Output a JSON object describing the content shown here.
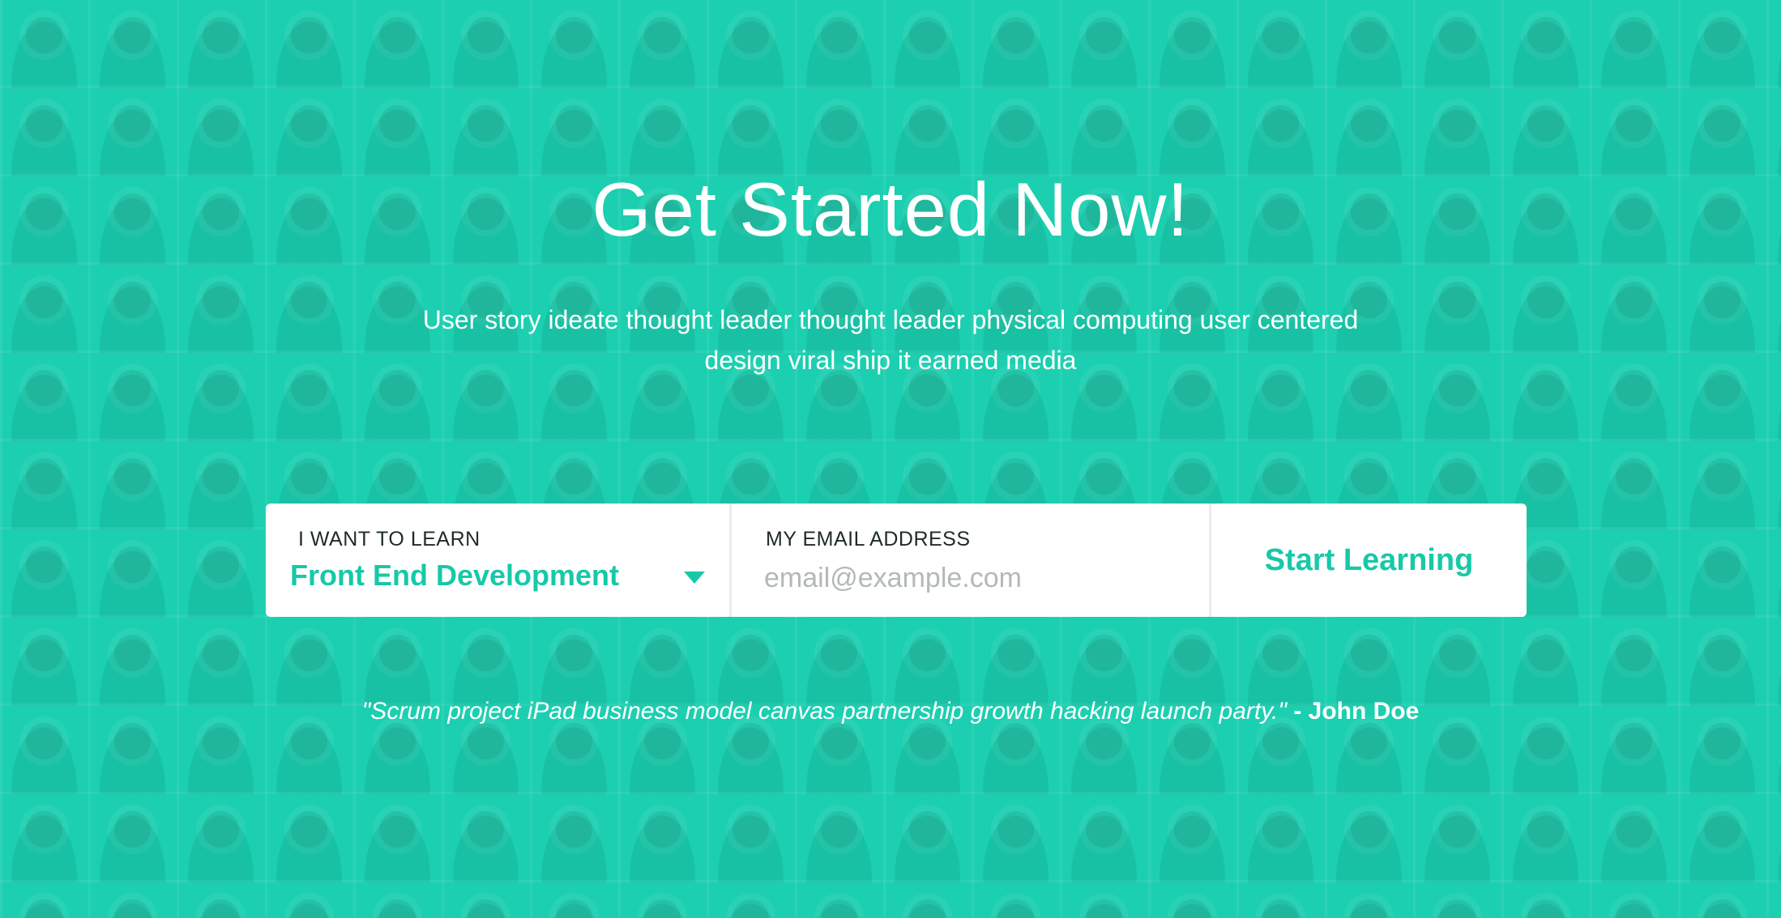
{
  "hero": {
    "title": "Get Started Now!",
    "subtitle": "User story ideate thought leader thought leader physical computing user centered design viral ship it earned media"
  },
  "form": {
    "learn_label": "I WANT TO LEARN",
    "learn_selected": "Front End Development",
    "email_label": "MY EMAIL ADDRESS",
    "email_placeholder": "email@example.com",
    "email_value": "",
    "submit_label": "Start Learning"
  },
  "testimonial": {
    "quote": "\"Scrum project iPad business model canvas partnership growth hacking launch party.\"",
    "author": " - John Doe"
  },
  "theme": {
    "accent": "#17c9a8",
    "background": "#1ccfb0",
    "text_on_accent": "#ffffff"
  },
  "icons": {
    "dropdown": "caret-down-icon",
    "background": "portrait-mosaic-background"
  }
}
